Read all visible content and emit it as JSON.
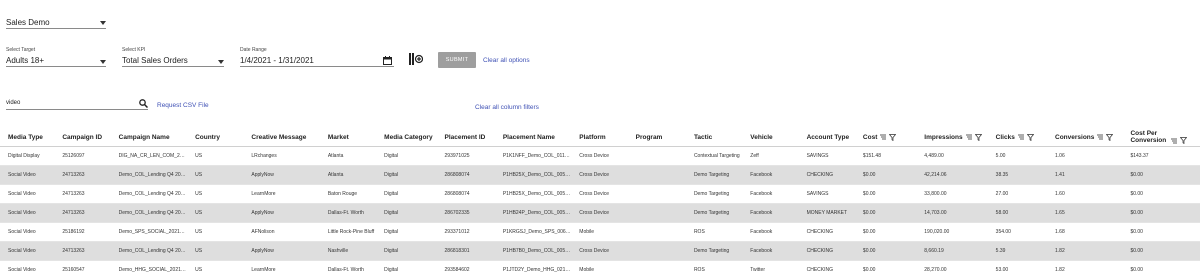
{
  "account": {
    "value": "Sales Demo"
  },
  "target": {
    "label": "Select Target",
    "value": "Adults 18+"
  },
  "kpi": {
    "label": "Select KPI",
    "value": "Total Sales Orders"
  },
  "date_range": {
    "label": "Date Range",
    "value": "1/4/2021 - 1/31/2021"
  },
  "submit_label": "SUBMIT",
  "clear_all_options": "Clear all options",
  "search": {
    "value": "video"
  },
  "request_csv": "Request CSV File",
  "clear_filters": "Clear all column filters",
  "table": {
    "columns": [
      "Media Type",
      "Campaign ID",
      "Campaign Name",
      "Country",
      "Creative Message",
      "Market",
      "Media Category",
      "Placement ID",
      "Placement Name",
      "Platform",
      "Program",
      "Tactic",
      "Vehicle",
      "Account Type",
      "Cost",
      "Impressions",
      "Clicks",
      "Conversions",
      "Cost Per Conversion"
    ],
    "rows": [
      [
        "Digital Display",
        "25126097",
        "DIG_NA_CR_LEN_COM_2…",
        "US",
        "LRchanges",
        "Atlanta",
        "Digital",
        "293971025",
        "P1K1NFF_Demo_COL_011…",
        "Cross Device",
        "",
        "Contextual Targeting",
        "Zeff",
        "SAVINGS",
        "$151.48",
        "4,489.00",
        "5.00",
        "1.06",
        "$143.37"
      ],
      [
        "Social Video",
        "24713263",
        "Demo_COL_Lending Q4 20…",
        "US",
        "ApplyNow",
        "Atlanta",
        "Digital",
        "286808074",
        "P1HB25X_Demo_COL_005…",
        "Cross Device",
        "",
        "Demo Targeting",
        "Facebook",
        "CHECKING",
        "$0.00",
        "42,214.06",
        "38.35",
        "1.41",
        "$0.00"
      ],
      [
        "Social Video",
        "24713263",
        "Demo_COL_Lending Q4 20…",
        "US",
        "LearnMore",
        "Baton Rouge",
        "Digital",
        "286808074",
        "P1HB25X_Demo_COL_005…",
        "Cross Device",
        "",
        "Demo Targeting",
        "Facebook",
        "SAVINGS",
        "$0.00",
        "33,800.00",
        "27.00",
        "1.60",
        "$0.00"
      ],
      [
        "Social Video",
        "24713263",
        "Demo_COL_Lending Q4 20…",
        "US",
        "ApplyNow",
        "Dallas-Ft. Worth",
        "Digital",
        "286702335",
        "P1HB24P_Demo_COL_005…",
        "Cross Device",
        "",
        "Demo Targeting",
        "Facebook",
        "MONEY MARKET",
        "$0.00",
        "14,703.00",
        "58.00",
        "1.65",
        "$0.00"
      ],
      [
        "Social Video",
        "25186192",
        "Demo_SPS_SOCIAL_2021…",
        "US",
        "AFNolison",
        "Little Rock-Pine Bluff",
        "Digital",
        "293371012",
        "P1KRGSJ_Demo_SPS_006…",
        "Mobile",
        "",
        "ROS",
        "Facebook",
        "CHECKING",
        "$0.00",
        "190,020.00",
        "354.00",
        "1.68",
        "$0.00"
      ],
      [
        "Social Video",
        "24713263",
        "Demo_COL_Lending Q4 20…",
        "US",
        "ApplyNow",
        "Nashville",
        "Digital",
        "286818301",
        "P1HB7B0_Demo_COL_005…",
        "Cross Device",
        "",
        "Demo Targeting",
        "Facebook",
        "CHECKING",
        "$0.00",
        "8,660.19",
        "5.39",
        "1.82",
        "$0.00"
      ],
      [
        "Social Video",
        "25160547",
        "Demo_HHG_SOCIAL_2021…",
        "US",
        "LearnMore",
        "Dallas-Ft. Worth",
        "Digital",
        "293584602",
        "P1JTD2Y_Demo_HHG_021…",
        "Mobile",
        "",
        "ROS",
        "Twitter",
        "CHECKING",
        "$0.00",
        "28,270.00",
        "53.00",
        "1.82",
        "$0.00"
      ]
    ]
  }
}
